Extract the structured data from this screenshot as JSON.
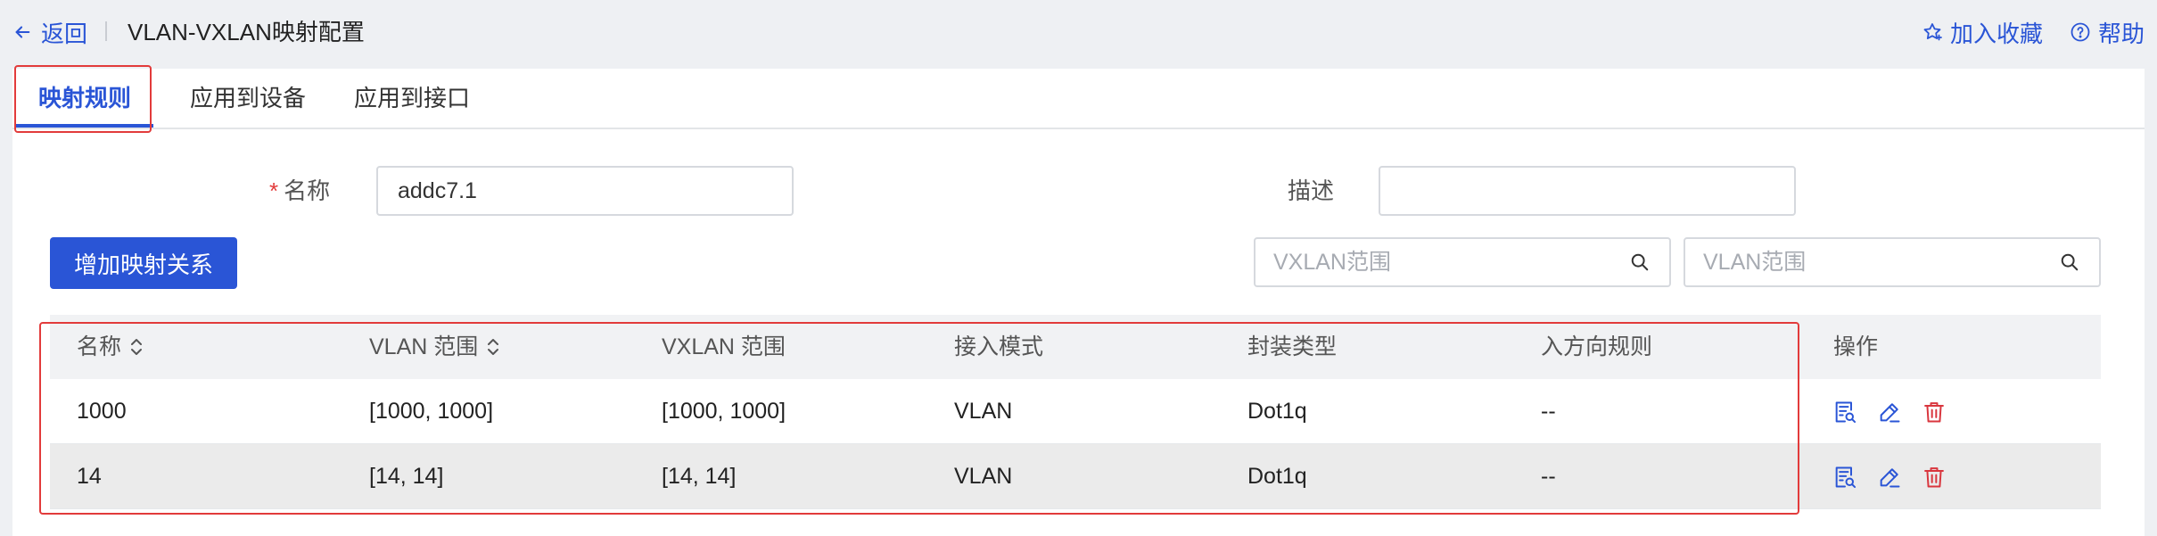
{
  "header": {
    "back_label": "返回",
    "title": "VLAN-VXLAN映射配置",
    "favorite_label": "加入收藏",
    "help_label": "帮助"
  },
  "tabs": [
    {
      "label": "映射规则",
      "active": true
    },
    {
      "label": "应用到设备",
      "active": false
    },
    {
      "label": "应用到接口",
      "active": false
    }
  ],
  "form": {
    "name_required_mark": "*",
    "name_label": "名称",
    "name_value": "addc7.1",
    "description_label": "描述",
    "description_value": ""
  },
  "toolbar": {
    "add_button_label": "增加映射关系",
    "vxlan_search_placeholder": "VXLAN范围",
    "vlan_search_placeholder": "VLAN范围"
  },
  "table": {
    "columns": [
      "名称",
      "VLAN 范围",
      "VXLAN 范围",
      "接入模式",
      "封装类型",
      "入方向规则",
      "操作"
    ],
    "rows": [
      {
        "name": "1000",
        "vlan_range": "[1000, 1000]",
        "vxlan_range": "[1000, 1000]",
        "access_mode": "VLAN",
        "encap_type": "Dot1q",
        "inbound_rule": "--"
      },
      {
        "name": "14",
        "vlan_range": "[14, 14]",
        "vxlan_range": "[14, 14]",
        "access_mode": "VLAN",
        "encap_type": "Dot1q",
        "inbound_rule": "--"
      }
    ]
  },
  "colors": {
    "accent": "#2a55d6",
    "highlight": "#e23b3b",
    "delete": "#d9363e"
  },
  "icons": {
    "back": "arrow-left-icon",
    "favorite": "star-plus-icon",
    "help": "question-circle-icon",
    "search": "search-icon",
    "sort": "sort-icon",
    "details": "details-icon",
    "edit": "edit-icon",
    "delete": "trash-icon"
  }
}
